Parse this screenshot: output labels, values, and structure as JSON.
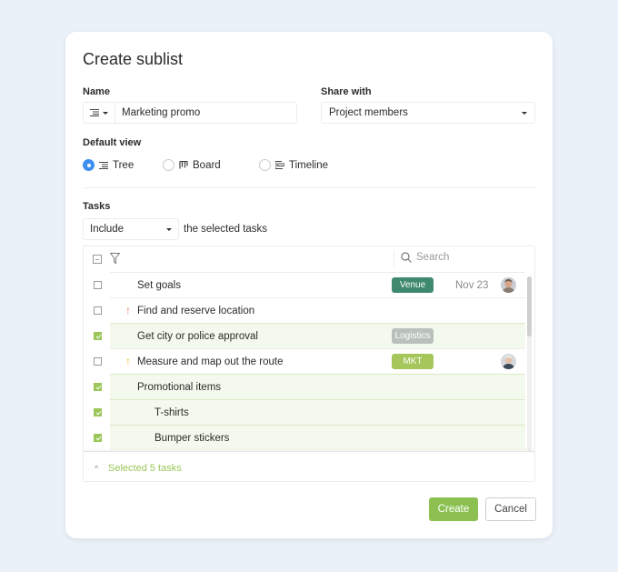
{
  "dialog": {
    "title": "Create sublist",
    "name_label": "Name",
    "name_value": "Marketing promo",
    "name_icon": "list-icon",
    "share_label": "Share with",
    "share_value": "Project members",
    "default_view_label": "Default view",
    "views": [
      {
        "label": "Tree",
        "icon": "tree-icon",
        "selected": true
      },
      {
        "label": "Board",
        "icon": "board-icon",
        "selected": false
      },
      {
        "label": "Timeline",
        "icon": "timeline-icon",
        "selected": false
      }
    ],
    "tasks_label": "Tasks",
    "include_value": "Include",
    "include_suffix": "the selected tasks",
    "search_placeholder": "Search",
    "tasks": [
      {
        "name": "Set goals",
        "checked": false,
        "priority": null,
        "tag": "Venue",
        "tag_color": "#3f8a6e",
        "date": "Nov 23",
        "avatar": "man",
        "indent": 1
      },
      {
        "name": "Find and reserve location",
        "checked": false,
        "priority": "high",
        "priority_color": "#e8735a",
        "tag": null,
        "date": null,
        "avatar": null,
        "indent": 1
      },
      {
        "name": "Get city or police approval",
        "checked": true,
        "priority": null,
        "tag": "Logistics",
        "tag_color": "#b8c1bb",
        "date": null,
        "avatar": null,
        "indent": 1
      },
      {
        "name": "Measure and map out the route",
        "checked": false,
        "priority": "medium",
        "priority_color": "#f4b43a",
        "tag": "MKT",
        "tag_color": "#a4c65a",
        "date": null,
        "avatar": "woman",
        "indent": 1
      },
      {
        "name": "Promotional items",
        "checked": true,
        "priority": null,
        "tag": null,
        "date": null,
        "avatar": null,
        "indent": 1
      },
      {
        "name": "T-shirts",
        "checked": true,
        "priority": null,
        "tag": null,
        "date": null,
        "avatar": null,
        "indent": 2
      },
      {
        "name": "Bumper stickers",
        "checked": true,
        "priority": null,
        "tag": null,
        "date": null,
        "avatar": null,
        "indent": 2
      }
    ],
    "selected_summary": "Selected 5 tasks",
    "create_label": "Create",
    "cancel_label": "Cancel",
    "accent_color": "#8cc152",
    "radio_color": "#3c8ff0"
  }
}
